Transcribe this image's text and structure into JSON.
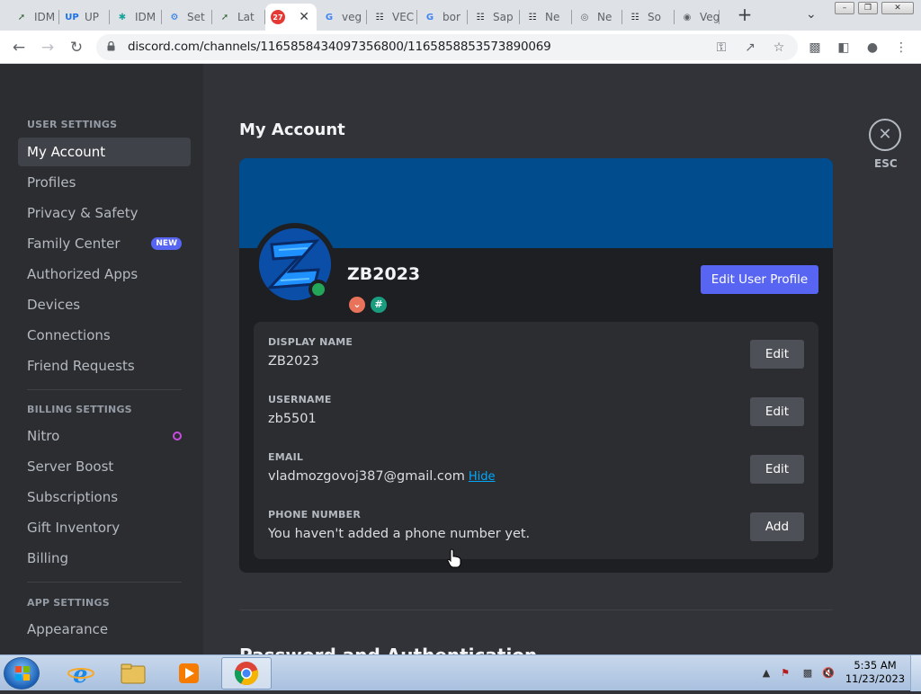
{
  "browser": {
    "tabs": [
      {
        "title": "IDM",
        "icon": "idm-icon",
        "color": "#2c5f2d"
      },
      {
        "title": "UP",
        "icon": "up-icon",
        "color": "#1a73e8"
      },
      {
        "title": "IDM",
        "icon": "puzzle-icon",
        "color": "#1aa39a"
      },
      {
        "title": "Set",
        "icon": "gear-icon",
        "color": "#1a73e8"
      },
      {
        "title": "Lat",
        "icon": "idm-icon",
        "color": "#2c5f2d"
      },
      {
        "title": "",
        "icon": "discord-badge-icon",
        "color": "#e53935",
        "badge": "27",
        "active": true
      },
      {
        "title": "veg",
        "icon": "google-icon",
        "color": "#4285f4"
      },
      {
        "title": "VEC",
        "icon": "bank-icon",
        "color": "#202124"
      },
      {
        "title": "bor",
        "icon": "google-icon",
        "color": "#4285f4"
      },
      {
        "title": "Sap",
        "icon": "bank-icon",
        "color": "#202124"
      },
      {
        "title": "Ne",
        "icon": "bank-icon",
        "color": "#202124"
      },
      {
        "title": "Ne",
        "icon": "chrome-icon",
        "color": "#5f6368"
      },
      {
        "title": "So",
        "icon": "bank-icon",
        "color": "#202124"
      },
      {
        "title": "Veg",
        "icon": "globe-icon",
        "color": "#5f6368"
      }
    ],
    "url": "discord.com/channels/1165858434097356800/1165858853573890069"
  },
  "sidebar": {
    "user_settings_header": "USER SETTINGS",
    "user_items": [
      {
        "label": "My Account",
        "selected": true
      },
      {
        "label": "Profiles"
      },
      {
        "label": "Privacy & Safety"
      },
      {
        "label": "Family Center",
        "badge": "NEW"
      },
      {
        "label": "Authorized Apps"
      },
      {
        "label": "Devices"
      },
      {
        "label": "Connections"
      },
      {
        "label": "Friend Requests"
      }
    ],
    "billing_settings_header": "BILLING SETTINGS",
    "billing_items": [
      {
        "label": "Nitro"
      },
      {
        "label": "Server Boost"
      },
      {
        "label": "Subscriptions"
      },
      {
        "label": "Gift Inventory"
      },
      {
        "label": "Billing"
      }
    ],
    "app_settings_header": "APP SETTINGS",
    "app_items": [
      {
        "label": "Appearance"
      }
    ]
  },
  "main": {
    "title": "My Account",
    "close_label": "ESC",
    "profile": {
      "username": "ZB2023",
      "edit_profile_label": "Edit User Profile",
      "banner_color": "#004c8c",
      "status": "online"
    },
    "fields": [
      {
        "label": "DISPLAY NAME",
        "value": "ZB2023",
        "button": "Edit"
      },
      {
        "label": "USERNAME",
        "value": "zb5501",
        "button": "Edit"
      },
      {
        "label": "EMAIL",
        "value": "vladmozgovoj387@gmail.com",
        "link": "Hide",
        "button": "Edit"
      },
      {
        "label": "PHONE NUMBER",
        "value": "You haven't added a phone number yet.",
        "button": "Add"
      }
    ],
    "next_section_partial": "Password and Authentication"
  },
  "taskbar": {
    "clock_time": "5:35 AM",
    "clock_date": "11/23/2023"
  }
}
